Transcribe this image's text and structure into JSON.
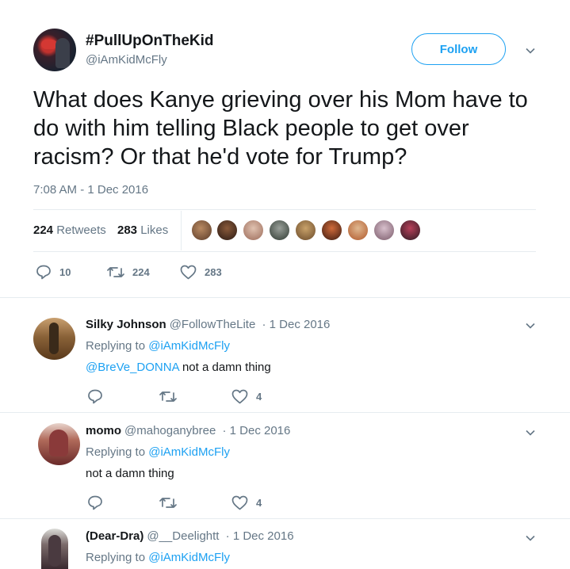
{
  "tweet": {
    "display_name": "#PullUpOnTheKid",
    "handle": "@iAmKidMcFly",
    "follow_label": "Follow",
    "text": "What does Kanye grieving over his Mom have to do with him telling Black people to get over racism? Or that he'd vote for Trump?",
    "timestamp": "7:08 AM - 1 Dec 2016",
    "retweets_count": "224",
    "retweets_label": "Retweets",
    "likes_count": "283",
    "likes_label": "Likes",
    "action_replies": "10",
    "action_retweets": "224",
    "action_likes": "283"
  },
  "replies": [
    {
      "name": "Silky Johnson",
      "handle": "@FollowTheLite",
      "date": "· 1 Dec 2016",
      "replying_prefix": "Replying to",
      "replying_to": "@iAmKidMcFly",
      "mention": "@BreVe_DONNA",
      "text": "not a damn thing",
      "likes": "4"
    },
    {
      "name": "momo",
      "handle": "@mahoganybree",
      "date": "· 1 Dec 2016",
      "replying_prefix": "Replying to",
      "replying_to": "@iAmKidMcFly",
      "text": "not a damn thing",
      "likes": "4"
    },
    {
      "name": "(Dear-Dra)",
      "handle": "@__Deelightt",
      "date": "· 1 Dec 2016",
      "replying_prefix": "Replying to",
      "replying_to": "@iAmKidMcFly"
    }
  ],
  "colors": {
    "accent": "#1da1f2",
    "secondary_text": "#657786",
    "primary_text": "#14171a",
    "divider": "#e6ecf0"
  },
  "icons": [
    "chevron-down-icon",
    "reply-icon",
    "retweet-icon",
    "like-icon"
  ]
}
